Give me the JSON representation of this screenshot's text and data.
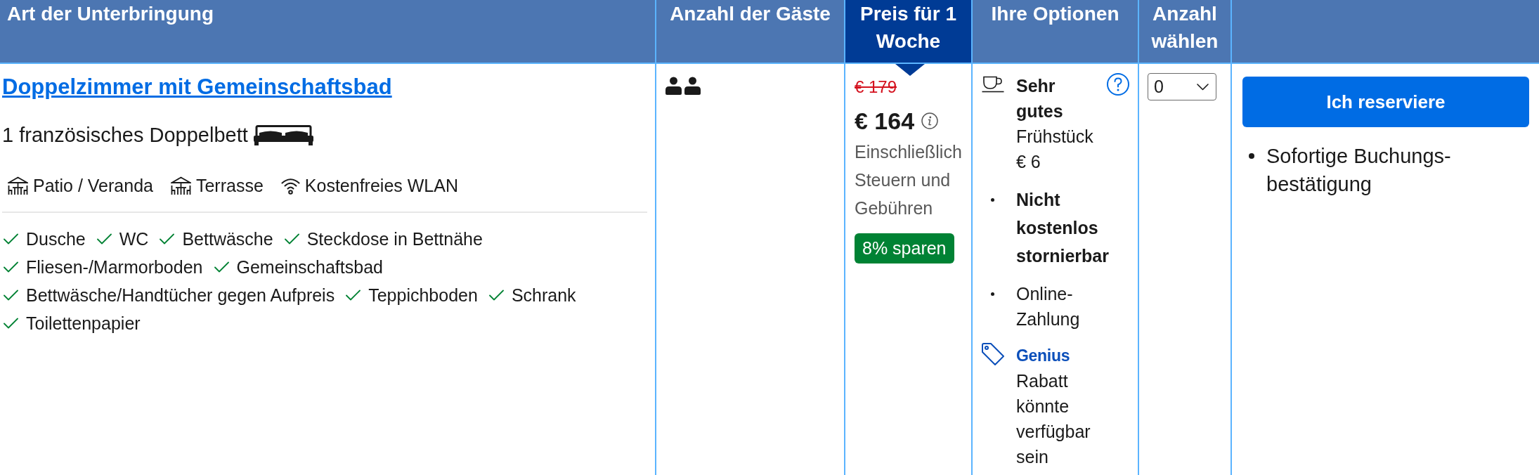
{
  "table": {
    "columns": [
      {
        "label": "Art der Unterbringung",
        "highlighted": false
      },
      {
        "label": "Anzahl der Gäste",
        "highlighted": false
      },
      {
        "label": "Preis für 1 Woche",
        "highlighted": true
      },
      {
        "label": "Ihre Optionen",
        "highlighted": false
      },
      {
        "label": "Anzahl wählen",
        "highlighted": false
      },
      {
        "highlighted": false
      }
    ],
    "rows": [
      {
        "room": {
          "name": "Doppelzimmer mit Gemeinschaftsbad",
          "bed": "1 französisches Doppelbett",
          "facilities": [
            {
              "kind": "patio",
              "label": "Patio / Veranda"
            },
            {
              "kind": "patio",
              "label": "Terrasse"
            },
            {
              "kind": "wifi",
              "label": "Kostenfreies WLAN"
            }
          ],
          "amenities": [
            "Dusche",
            "WC",
            "Bettwäsche",
            "Steckdose in Bettnähe",
            "Fliesen-/Marmorboden",
            "Gemeinschaftsbad",
            "Bettwäsche/Handtücher gegen Aufpreis",
            "Teppichboden",
            "Schrank",
            "Toilettenpapier"
          ]
        },
        "guests": [
          {
            "kind": "adult"
          },
          {
            "kind": "adult"
          }
        ],
        "price": {
          "original": "€ 179",
          "current": "€ 164",
          "note": "Einschließlich Steuern und Gebühren",
          "badge": "8% sparen"
        },
        "options": [
          {
            "kind": "meal",
            "text": "**Sehr gutes** Frühstück € 6"
          },
          {
            "kind": "bullet",
            "text": "Nicht kostenlos stornierbar",
            "bold": true
          },
          {
            "kind": "bullet",
            "text": "Online-Zahlung",
            "bold": false
          },
          {
            "kind": "genius",
            "brand": "Genius",
            "text": "Rabatt könnte verfügbar sein"
          }
        ],
        "quantity": "0",
        "reserve_button": "Ich reserviere",
        "benefits": [
          "Sofortige Buchungs-bestätigung"
        ]
      }
    ]
  }
}
